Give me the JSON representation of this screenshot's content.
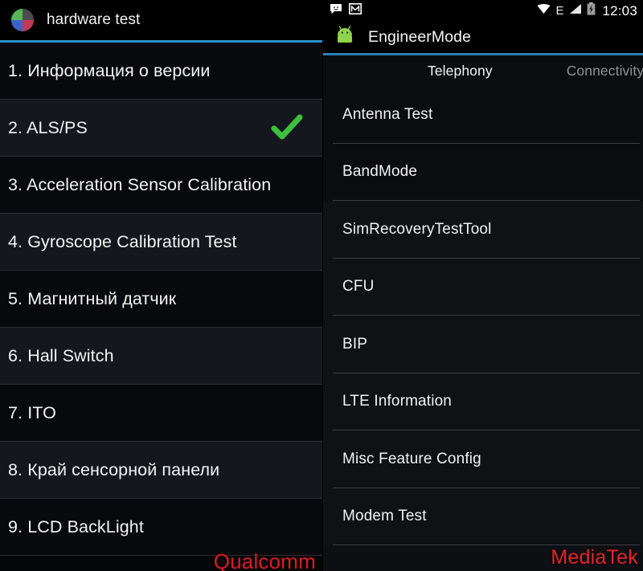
{
  "left_panel": {
    "header": {
      "title": "hardware test",
      "icon": "hardware-test-icon",
      "accent_color": "#2a93c8"
    },
    "items": [
      {
        "label": "1. Информация о версии",
        "checked": false
      },
      {
        "label": "2. ALS/PS",
        "checked": true
      },
      {
        "label": "3. Acceleration Sensor Calibration",
        "checked": false
      },
      {
        "label": "4. Gyroscope Calibration Test",
        "checked": false
      },
      {
        "label": "5. Магнитный датчик",
        "checked": false
      },
      {
        "label": "6. Hall Switch",
        "checked": false
      },
      {
        "label": "7. ITO",
        "checked": false
      },
      {
        "label": "8. Край сенсорной панели",
        "checked": false
      },
      {
        "label": "9. LCD BackLight",
        "checked": false
      }
    ],
    "watermark": "Qualcomm",
    "watermark_color": "#e01b24",
    "check_color": "#3fbf3f"
  },
  "right_panel": {
    "status_bar": {
      "left_icons": [
        "sms-icon",
        "gmail-icon"
      ],
      "wifi_icon": "wifi-icon",
      "network_type": "E",
      "signal_icon": "signal-icon",
      "battery_icon": "battery-charging-icon",
      "clock": "12:03"
    },
    "header": {
      "title": "EngineerMode",
      "icon": "android-robot-icon",
      "accent_color": "#2b7fb8"
    },
    "tabs": [
      {
        "label": "Telephony",
        "active": true
      },
      {
        "label": "Connectivity",
        "active": false
      }
    ],
    "items": [
      {
        "label": "Antenna Test"
      },
      {
        "label": "BandMode"
      },
      {
        "label": "SimRecoveryTestTool"
      },
      {
        "label": "CFU"
      },
      {
        "label": "BIP"
      },
      {
        "label": "LTE Information"
      },
      {
        "label": "Misc Feature Config"
      },
      {
        "label": "Modem Test"
      }
    ],
    "watermark": "MediaTek",
    "watermark_color": "#e8242c"
  }
}
